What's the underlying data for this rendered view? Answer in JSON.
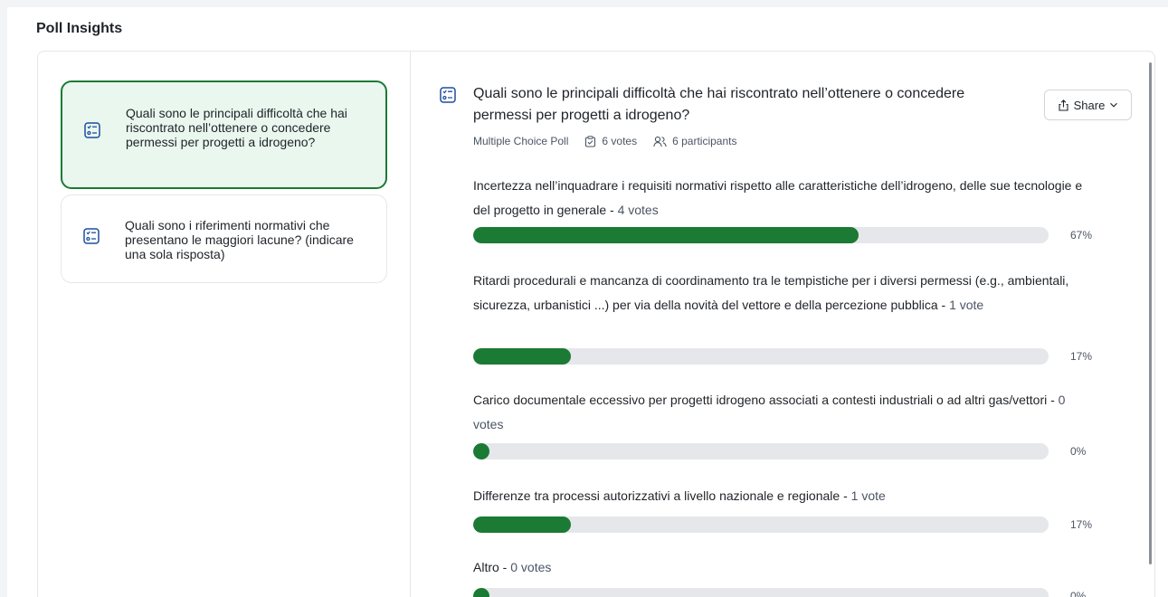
{
  "page": {
    "title": "Poll Insights"
  },
  "questions": [
    {
      "text": "Quali sono le principali difficoltà che hai riscontrato nell’ottenere o concedere permessi per progetti a idrogeno?",
      "active": true,
      "icon": "poll-icon"
    },
    {
      "text": "Quali sono i riferimenti normativi che presentano le maggiori lacune? (indicare una sola risposta)",
      "active": false,
      "icon": "poll-icon"
    }
  ],
  "detail": {
    "question": "Quali sono le principali difficoltà che hai riscontrato nell’ottenere o concedere permessi per progetti a idrogeno?",
    "poll_type": "Multiple Choice Poll",
    "votes": "6 votes",
    "participants": "6 participants",
    "share_label": "Share",
    "options": [
      {
        "label": "Incertezza nell’inquadrare i requisiti normativi rispetto alle caratteristiche dell’idrogeno, delle sue tecnologie e del progetto in generale",
        "votes": "4 votes",
        "percent_label": "67%",
        "fraction": 0.67
      },
      {
        "label": "Ritardi procedurali e mancanza di coordinamento tra le tempistiche per i diversi permessi (e.g., ambientali, sicurezza, urbanistici ...) per via della novità del vettore e della percezione pubblica",
        "votes": "1 vote",
        "percent_label": "17%",
        "fraction": 0.17
      },
      {
        "label": "Carico documentale eccessivo per progetti idrogeno associati a contesti industriali o ad altri gas/vettori",
        "votes": "0 votes",
        "percent_label": "0%",
        "fraction": 0
      },
      {
        "label": "Differenze tra processi autorizzativi a livello nazionale e regionale",
        "votes": "1 vote",
        "percent_label": "17%",
        "fraction": 0.17
      },
      {
        "label": "Altro",
        "votes": "0 votes",
        "percent_label": "0%",
        "fraction": 0
      }
    ]
  },
  "colors": {
    "accent": "#1b7a34",
    "active_bg": "#eaf7ef",
    "track": "#e5e7eb"
  }
}
